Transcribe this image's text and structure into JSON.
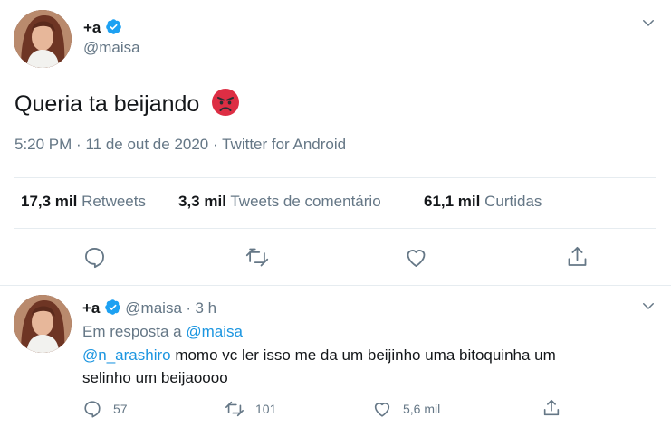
{
  "tweet": {
    "name": "+a",
    "handle": "@maisa",
    "text": "Queria ta beijando",
    "emoji": "😡",
    "time": "5:20 PM",
    "date": "11 de out de 2020",
    "source": "Twitter for Android",
    "sep": "·",
    "stats": {
      "retweets_count": "17,3 mil",
      "retweets_label": "Retweets",
      "comments_count": "3,3 mil",
      "comments_label": "Tweets de comentário",
      "likes_count": "61,1 mil",
      "likes_label": "Curtidas"
    },
    "icons": [
      "reply-icon",
      "retweet-icon",
      "like-icon",
      "share-icon",
      "verified-icon",
      "chevron-down-icon"
    ]
  },
  "reply": {
    "name": "+a",
    "handle": "@maisa",
    "sep": "·",
    "age": "3 h",
    "in_reply_prefix": "Em resposta a",
    "in_reply_handle": "@maisa",
    "mention": "@n_arashiro",
    "text_line1": " momo vc ler isso me da um beijinho uma bitoquinha um",
    "text_line2": "selinho um beijaoooo",
    "replies": "57",
    "retweets": "101",
    "likes": "5,6 mil"
  },
  "colors": {
    "accent": "#1b95e0",
    "verified": "#1da1f2",
    "muted": "#657786",
    "divider": "#e6ecf0"
  }
}
